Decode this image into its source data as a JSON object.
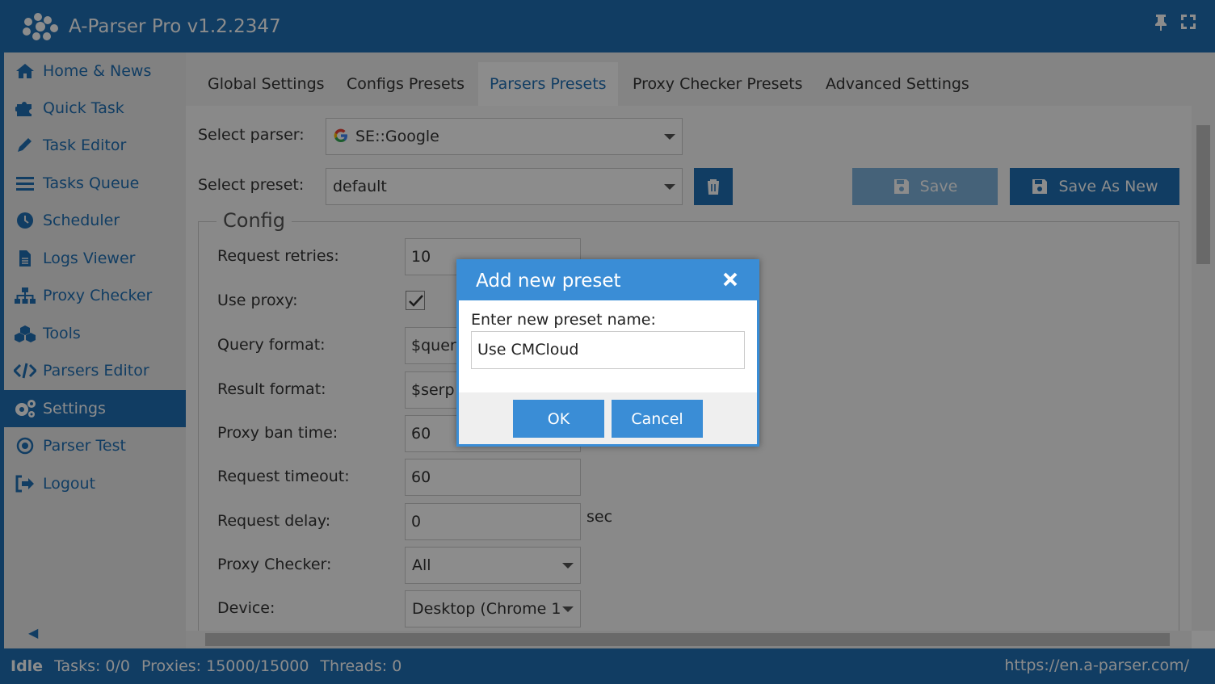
{
  "app": {
    "title": "A-Parser Pro v1.2.2347"
  },
  "sidebar": {
    "items": [
      {
        "label": "Home & News",
        "icon": "home-icon"
      },
      {
        "label": "Quick Task",
        "icon": "puzzle-icon"
      },
      {
        "label": "Task Editor",
        "icon": "pencil-icon"
      },
      {
        "label": "Tasks Queue",
        "icon": "list-icon"
      },
      {
        "label": "Scheduler",
        "icon": "clock-icon"
      },
      {
        "label": "Logs Viewer",
        "icon": "file-icon"
      },
      {
        "label": "Proxy Checker",
        "icon": "sitemap-icon"
      },
      {
        "label": "Tools",
        "icon": "cubes-icon"
      },
      {
        "label": "Parsers Editor",
        "icon": "code-icon"
      },
      {
        "label": "Settings",
        "icon": "gears-icon",
        "active": true
      },
      {
        "label": "Parser Test",
        "icon": "target-icon"
      },
      {
        "label": "Logout",
        "icon": "logout-icon"
      }
    ]
  },
  "tabs": [
    {
      "label": "Global Settings"
    },
    {
      "label": "Configs Presets"
    },
    {
      "label": "Parsers Presets",
      "active": true
    },
    {
      "label": "Proxy Checker Presets"
    },
    {
      "label": "Advanced Settings"
    }
  ],
  "form": {
    "select_parser_label": "Select parser:",
    "select_parser_value": "SE::Google",
    "select_preset_label": "Select preset:",
    "select_preset_value": "default",
    "save_label": "Save",
    "save_as_new_label": "Save As New"
  },
  "config": {
    "legend": "Config",
    "rows": {
      "request_retries": {
        "label": "Request retries:",
        "value": "10"
      },
      "use_proxy": {
        "label": "Use proxy:",
        "checked": true
      },
      "query_format": {
        "label": "Query format:",
        "value": "$query"
      },
      "result_format": {
        "label": "Result format:",
        "value": "$serp"
      },
      "proxy_ban_time": {
        "label": "Proxy ban time:",
        "value": "60"
      },
      "request_timeout": {
        "label": "Request timeout:",
        "value": "60"
      },
      "request_delay": {
        "label": "Request delay:",
        "value": "0",
        "unit": "sec"
      },
      "proxy_checker": {
        "label": "Proxy Checker:",
        "value": "All"
      },
      "device": {
        "label": "Device:",
        "value": "Desktop (Chrome 1"
      }
    }
  },
  "status": {
    "state": "Idle",
    "tasks": "Tasks: 0/0",
    "proxies": "Proxies: 15000/15000",
    "threads": "Threads: 0",
    "url": "https://en.a-parser.com/"
  },
  "dialog": {
    "title": "Add new preset",
    "prompt": "Enter new preset name:",
    "input_value": "Use CMCloud",
    "ok_label": "OK",
    "cancel_label": "Cancel"
  },
  "colors": {
    "primary": "#1f6fb4",
    "dialog_accent": "#3a8dd6"
  }
}
